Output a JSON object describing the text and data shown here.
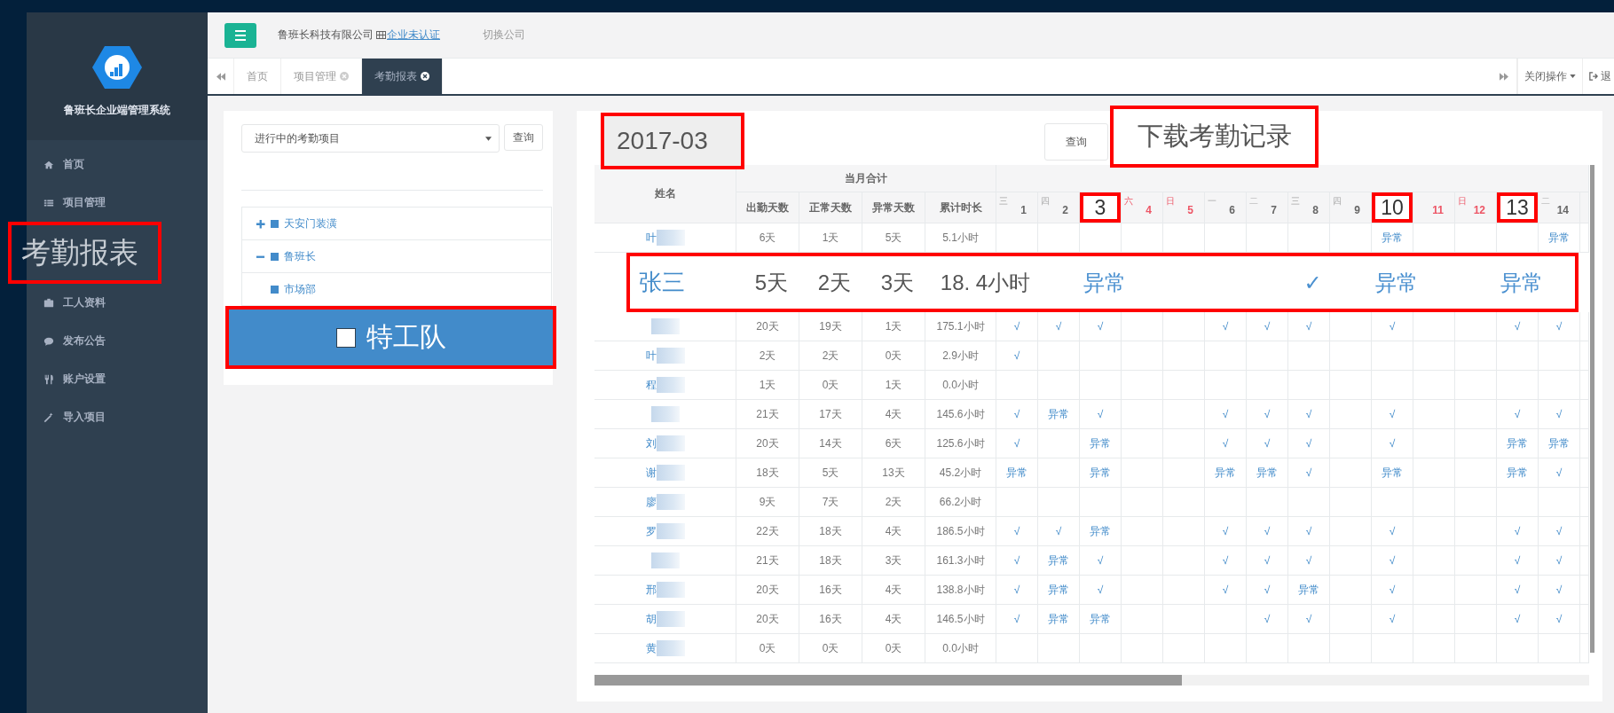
{
  "sidebar": {
    "title": "鲁班长企业端管理系统",
    "items": [
      {
        "label": "首页",
        "selected": false,
        "callout": false
      },
      {
        "label": "项目管理",
        "selected": false,
        "callout": false
      },
      {
        "label": "考勤报表",
        "selected": true,
        "callout": true
      },
      {
        "label": "工人资料",
        "selected": false,
        "callout": false
      },
      {
        "label": "发布公告",
        "selected": false,
        "callout": false
      },
      {
        "label": "账户设置",
        "selected": false,
        "callout": false
      },
      {
        "label": "导入项目",
        "selected": false,
        "callout": false
      }
    ]
  },
  "header": {
    "company": "鲁班长科技有限公司",
    "cert_link": "企业未认证",
    "switch_company": "切换公司"
  },
  "tabs": [
    {
      "label": "首页",
      "closable": false,
      "selected": false
    },
    {
      "label": "项目管理",
      "closable": true,
      "selected": false
    },
    {
      "label": "考勤报表",
      "closable": true,
      "selected": true
    }
  ],
  "tab_actions": {
    "close_menu": "关闭操作",
    "logout": "退"
  },
  "filter": {
    "project_select": "进行中的考勤项目",
    "query_button": "查询"
  },
  "tree": [
    {
      "label": "天安门装潢",
      "expanded": false,
      "selected": false
    },
    {
      "label": "鲁班长",
      "expanded": true,
      "selected": false,
      "children": [
        {
          "label": "市场部",
          "selected": false,
          "callout": false
        },
        {
          "label": "特工队",
          "selected": true,
          "callout": true
        }
      ]
    }
  ],
  "report": {
    "month": "2017-03",
    "query_button": "查询",
    "download_button": "下载考勤记录"
  },
  "table": {
    "name_header": "姓名",
    "group_header": "当月合计",
    "stat_headers": [
      "出勤天数",
      "正常天数",
      "异常天数",
      "累计时长"
    ],
    "days": [
      {
        "weekday": "三",
        "day": "1",
        "weekend": false,
        "callout": false
      },
      {
        "weekday": "四",
        "day": "2",
        "weekend": false,
        "callout": false
      },
      {
        "day": "3",
        "weekend": false,
        "callout": true
      },
      {
        "weekday": "六",
        "day": "4",
        "weekend": true,
        "callout": false
      },
      {
        "weekday": "日",
        "day": "5",
        "weekend": true,
        "callout": false
      },
      {
        "weekday": "一",
        "day": "6",
        "weekend": false,
        "callout": false
      },
      {
        "weekday": "二",
        "day": "7",
        "weekend": false,
        "callout": false
      },
      {
        "weekday": "三",
        "day": "8",
        "weekend": false,
        "callout": false
      },
      {
        "weekday": "四",
        "day": "9",
        "weekend": false,
        "callout": false
      },
      {
        "day": "10",
        "weekend": false,
        "callout": true
      },
      {
        "day": "11",
        "weekend": true,
        "callout": false
      },
      {
        "weekday": "日",
        "day": "12",
        "weekend": true,
        "callout": false
      },
      {
        "day": "13",
        "weekend": false,
        "callout": true
      },
      {
        "weekday": "二",
        "day": "14",
        "weekend": false,
        "callout": false
      }
    ],
    "rows": [
      {
        "kind": "normal",
        "name": "叶",
        "stats": [
          "6天",
          "1天",
          "5天",
          "5.1小时"
        ],
        "cells": [
          "",
          "",
          "",
          "",
          "",
          "",
          "",
          "",
          "",
          "异常",
          "",
          "",
          "",
          "异常"
        ]
      },
      {
        "kind": "callout",
        "name": "张三",
        "stats": [
          "5天",
          "2天",
          "3天",
          "18. 4小时"
        ],
        "cells": [
          "",
          "",
          "异常",
          "",
          "",
          "",
          "",
          "✓",
          "",
          "异常",
          "",
          "",
          "异常",
          ""
        ]
      },
      {
        "kind": "normal",
        "stats": [
          "20天",
          "19天",
          "1天",
          "175.1小时"
        ],
        "cells": [
          "√",
          "√",
          "√",
          "",
          "",
          "√",
          "√",
          "√",
          "",
          "√",
          "",
          "",
          "√",
          "√"
        ]
      },
      {
        "kind": "normal",
        "name": "叶",
        "stats": [
          "2天",
          "2天",
          "0天",
          "2.9小时"
        ],
        "cells": [
          "√",
          "",
          "",
          "",
          "",
          "",
          "",
          "",
          "",
          "",
          "",
          "",
          "",
          ""
        ]
      },
      {
        "kind": "normal",
        "name": "程",
        "stats": [
          "1天",
          "0天",
          "1天",
          "0.0小时"
        ]
      },
      {
        "kind": "normal",
        "stats": [
          "21天",
          "17天",
          "4天",
          "145.6小时"
        ],
        "cells": [
          "√",
          "异常",
          "√",
          "",
          "",
          "√",
          "√",
          "√",
          "",
          "√",
          "",
          "",
          "√",
          "√"
        ]
      },
      {
        "kind": "normal",
        "name": "刘",
        "stats": [
          "20天",
          "14天",
          "6天",
          "125.6小时"
        ],
        "cells": [
          "√",
          "",
          "异常",
          "",
          "",
          "√",
          "√",
          "√",
          "",
          "√",
          "",
          "",
          "异常",
          "异常"
        ]
      },
      {
        "kind": "normal",
        "name": "谢",
        "stats": [
          "18天",
          "5天",
          "13天",
          "45.2小时"
        ],
        "cells": [
          "异常",
          "",
          "异常",
          "",
          "",
          "异常",
          "异常",
          "√",
          "",
          "异常",
          "",
          "",
          "异常",
          "√"
        ]
      },
      {
        "kind": "normal",
        "name": "廖",
        "stats": [
          "9天",
          "7天",
          "2天",
          "66.2小时"
        ]
      },
      {
        "kind": "normal",
        "name": "罗",
        "stats": [
          "22天",
          "18天",
          "4天",
          "186.5小时"
        ],
        "cells": [
          "√",
          "√",
          "异常",
          "",
          "",
          "√",
          "√",
          "√",
          "",
          "√",
          "",
          "",
          "√",
          "√"
        ]
      },
      {
        "kind": "normal",
        "stats": [
          "21天",
          "18天",
          "3天",
          "161.3小时"
        ],
        "cells": [
          "√",
          "异常",
          "√",
          "",
          "",
          "√",
          "√",
          "√",
          "",
          "√",
          "",
          "",
          "√",
          "√"
        ]
      },
      {
        "kind": "normal",
        "name": "邢",
        "stats": [
          "20天",
          "16天",
          "4天",
          "138.8小时"
        ],
        "cells": [
          "√",
          "异常",
          "√",
          "",
          "",
          "√",
          "√",
          "异常",
          "",
          "√",
          "",
          "",
          "√",
          "√"
        ]
      },
      {
        "kind": "normal",
        "name": "胡",
        "stats": [
          "20天",
          "16天",
          "4天",
          "146.5小时"
        ],
        "cells": [
          "√",
          "异常",
          "异常",
          "",
          "",
          "",
          "√",
          "√",
          "",
          "√",
          "",
          "",
          "√",
          "√"
        ]
      },
      {
        "kind": "normal",
        "name": "黄",
        "stats": [
          "0天",
          "0天",
          "0天",
          "0.0小时"
        ]
      }
    ]
  }
}
